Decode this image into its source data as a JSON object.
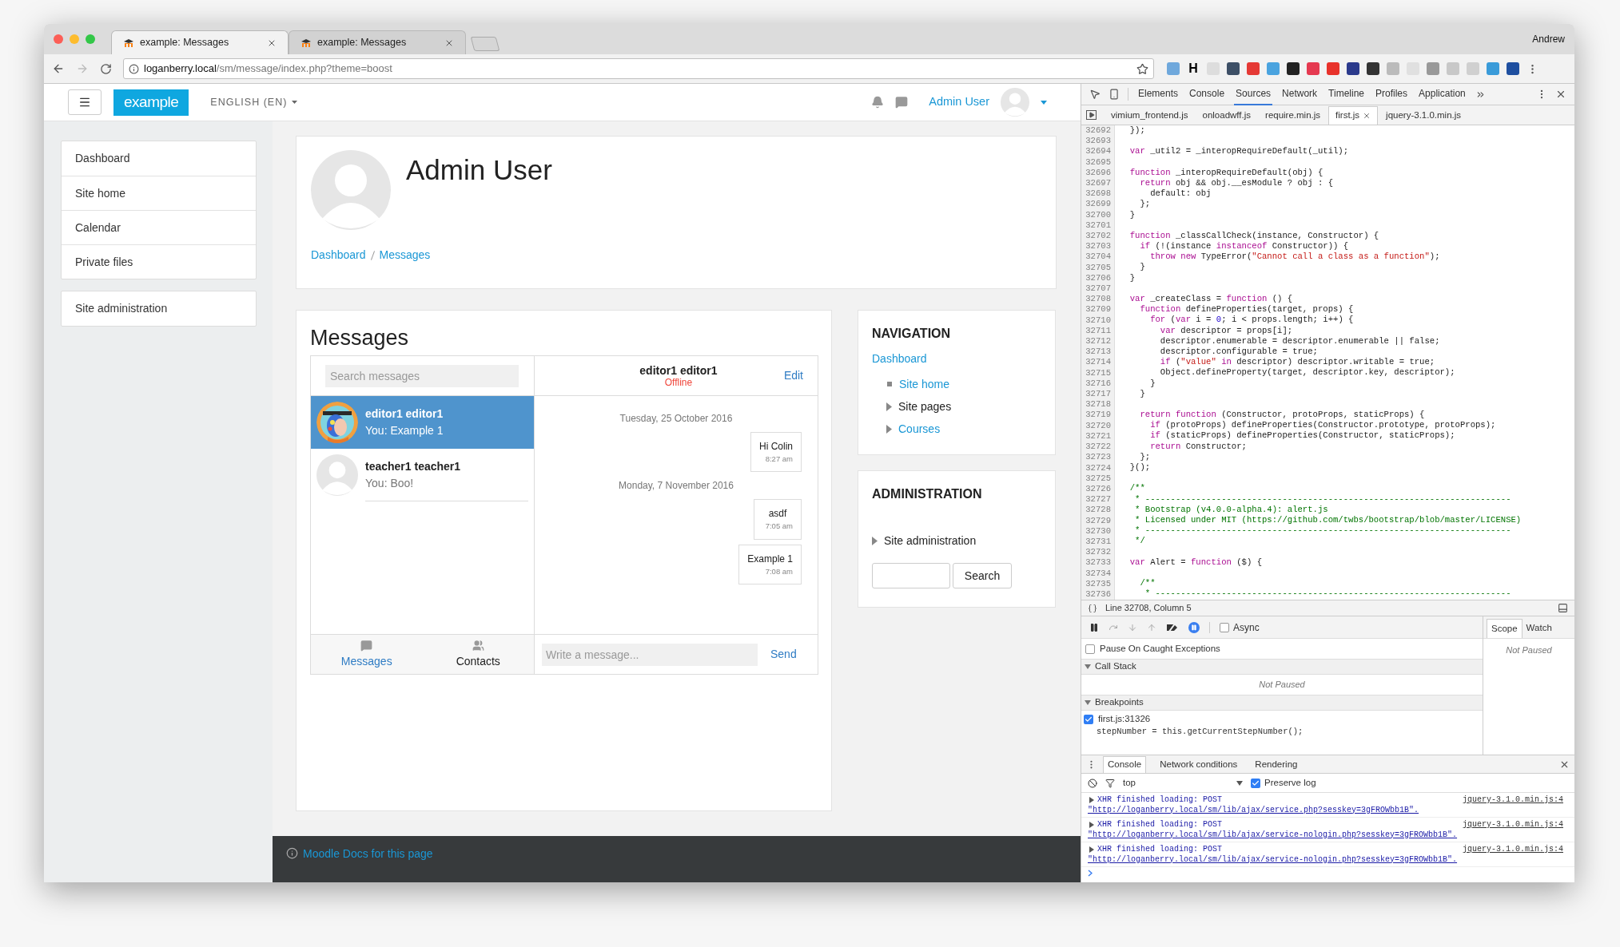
{
  "browser": {
    "tabs": [
      {
        "title": "example: Messages",
        "selected": true
      },
      {
        "title": "example: Messages",
        "selected": false
      }
    ],
    "profile": "Andrew",
    "url_host": "loganberry.local",
    "url_path": "/sm/message/index.php?theme=boost",
    "extension_letter": "H"
  },
  "navbar": {
    "logo": "example",
    "language": "ENGLISH (EN)",
    "user": "Admin User"
  },
  "sidebar": {
    "groups": [
      {
        "items": [
          "Dashboard",
          "Site home",
          "Calendar",
          "Private files"
        ]
      },
      {
        "items": [
          "Site administration"
        ]
      }
    ]
  },
  "header": {
    "name": "Admin User",
    "breadcrumb": [
      "Dashboard",
      "Messages"
    ]
  },
  "messages": {
    "title": "Messages",
    "search_placeholder": "Search messages",
    "conversations": [
      {
        "name": "editor1 editor1",
        "preview": "You: Example 1",
        "selected": true,
        "kind": "picture"
      },
      {
        "name": "teacher1 teacher1",
        "preview": "You: Boo!",
        "selected": false,
        "kind": "avatar"
      }
    ],
    "contact": {
      "name": "editor1 editor1",
      "status": "Offline"
    },
    "edit": "Edit",
    "thread": [
      {
        "kind": "date",
        "text": "Tuesday, 25 October 2016"
      },
      {
        "kind": "message",
        "text": "Hi Colin",
        "time": "8:27 am"
      },
      {
        "kind": "date",
        "text": "Monday, 7 November 2016"
      },
      {
        "kind": "message",
        "text": "asdf",
        "time": "7:05 am"
      },
      {
        "kind": "message",
        "text": "Example 1",
        "time": "7:08 am"
      }
    ],
    "tabs": [
      {
        "label": "Messages",
        "selected": true
      },
      {
        "label": "Contacts",
        "selected": false
      }
    ],
    "compose_placeholder": "Write a message...",
    "send": "Send"
  },
  "navigation": {
    "title": "NAVIGATION",
    "root": "Dashboard",
    "items": [
      {
        "label": "Site home",
        "kind": "leaf",
        "link": true
      },
      {
        "label": "Site pages",
        "kind": "branch",
        "link": false
      },
      {
        "label": "Courses",
        "kind": "branch",
        "link": true
      }
    ]
  },
  "administration": {
    "title": "ADMINISTRATION",
    "items": [
      {
        "label": "Site administration",
        "kind": "branch"
      }
    ],
    "search_button": "Search"
  },
  "footer": {
    "docs_link": "Moodle Docs for this page"
  },
  "devtools": {
    "panels": [
      {
        "label": "Elements",
        "selected": false
      },
      {
        "label": "Console",
        "selected": false
      },
      {
        "label": "Sources",
        "selected": true
      },
      {
        "label": "Network",
        "selected": false
      },
      {
        "label": "Timeline",
        "selected": false
      },
      {
        "label": "Profiles",
        "selected": false
      },
      {
        "label": "Application",
        "selected": false
      }
    ],
    "files": [
      {
        "name": "vimium_frontend.js",
        "selected": false
      },
      {
        "name": "onloadwff.js",
        "selected": false
      },
      {
        "name": "require.min.js",
        "selected": false
      },
      {
        "name": "first.js",
        "selected": true
      },
      {
        "name": "jquery-3.1.0.min.js",
        "selected": false
      }
    ],
    "code": [
      {
        "n": "32692",
        "segs": [
          {
            "text": "  });"
          }
        ]
      },
      {
        "n": "32693"
      },
      {
        "n": "32694",
        "segs": [
          {
            "text": "  var",
            "kind": "keyword"
          },
          {
            "text": " _util2 = _interopRequireDefault(_util);"
          }
        ]
      },
      {
        "n": "32695"
      },
      {
        "n": "32696",
        "segs": [
          {
            "text": "  function",
            "kind": "keyword"
          },
          {
            "text": " _interopRequireDefault(obj) {"
          }
        ]
      },
      {
        "n": "32697",
        "segs": [
          {
            "text": "    return",
            "kind": "keyword"
          },
          {
            "text": " obj && obj.__esModule ? obj : {"
          }
        ]
      },
      {
        "n": "32698",
        "segs": [
          {
            "text": "      default: obj"
          }
        ]
      },
      {
        "n": "32699",
        "segs": [
          {
            "text": "    };"
          }
        ]
      },
      {
        "n": "32700",
        "segs": [
          {
            "text": "  }"
          }
        ]
      },
      {
        "n": "32701"
      },
      {
        "n": "32702",
        "segs": [
          {
            "text": "  function",
            "kind": "keyword"
          },
          {
            "text": " _classCallCheck(instance, Constructor) {"
          }
        ]
      },
      {
        "n": "32703",
        "segs": [
          {
            "text": "    if",
            "kind": "keyword"
          },
          {
            "text": " (!(instance "
          },
          {
            "text": "instanceof",
            "kind": "keyword"
          },
          {
            "text": " Constructor)) {"
          }
        ]
      },
      {
        "n": "32704",
        "segs": [
          {
            "text": "      throw new",
            "kind": "keyword"
          },
          {
            "text": " TypeError("
          },
          {
            "text": "\"Cannot call a class as a function\"",
            "kind": "string"
          },
          {
            "text": ");"
          }
        ]
      },
      {
        "n": "32705",
        "segs": [
          {
            "text": "    }"
          }
        ]
      },
      {
        "n": "32706",
        "segs": [
          {
            "text": "  }"
          }
        ]
      },
      {
        "n": "32707"
      },
      {
        "n": "32708",
        "segs": [
          {
            "text": "  var",
            "kind": "keyword"
          },
          {
            "text": " _createClass = "
          },
          {
            "text": "function",
            "kind": "keyword"
          },
          {
            "text": " () {"
          }
        ]
      },
      {
        "n": "32709",
        "segs": [
          {
            "text": "    function",
            "kind": "keyword"
          },
          {
            "text": " defineProperties(target, props) {"
          }
        ]
      },
      {
        "n": "32710",
        "segs": [
          {
            "text": "      for",
            "kind": "keyword"
          },
          {
            "text": " ("
          },
          {
            "text": "var",
            "kind": "keyword"
          },
          {
            "text": " i = "
          },
          {
            "text": "0",
            "kind": "number"
          },
          {
            "text": "; i < props.length; i++) {"
          }
        ]
      },
      {
        "n": "32711",
        "segs": [
          {
            "text": "        var",
            "kind": "keyword"
          },
          {
            "text": " descriptor = props[i];"
          }
        ]
      },
      {
        "n": "32712",
        "segs": [
          {
            "text": "        descriptor.enumerable = descriptor.enumerable || false;"
          }
        ]
      },
      {
        "n": "32713",
        "segs": [
          {
            "text": "        descriptor.configurable = true;"
          }
        ]
      },
      {
        "n": "32714",
        "segs": [
          {
            "text": "        if",
            "kind": "keyword"
          },
          {
            "text": " ("
          },
          {
            "text": "\"value\"",
            "kind": "string"
          },
          {
            "text": " in",
            "kind": "keyword"
          },
          {
            "text": " descriptor) descriptor.writable = true;"
          }
        ]
      },
      {
        "n": "32715",
        "segs": [
          {
            "text": "        Object.defineProperty(target, descriptor.key, descriptor);"
          }
        ]
      },
      {
        "n": "32716",
        "segs": [
          {
            "text": "      }"
          }
        ]
      },
      {
        "n": "32717",
        "segs": [
          {
            "text": "    }"
          }
        ]
      },
      {
        "n": "32718"
      },
      {
        "n": "32719",
        "segs": [
          {
            "text": "    return function",
            "kind": "keyword"
          },
          {
            "text": " (Constructor, protoProps, staticProps) {"
          }
        ]
      },
      {
        "n": "32720",
        "segs": [
          {
            "text": "      if",
            "kind": "keyword"
          },
          {
            "text": " (protoProps) defineProperties(Constructor.prototype, protoProps);"
          }
        ]
      },
      {
        "n": "32721",
        "segs": [
          {
            "text": "      if",
            "kind": "keyword"
          },
          {
            "text": " (staticProps) defineProperties(Constructor, staticProps);"
          }
        ]
      },
      {
        "n": "32722",
        "segs": [
          {
            "text": "      return",
            "kind": "keyword"
          },
          {
            "text": " Constructor;"
          }
        ]
      },
      {
        "n": "32723",
        "segs": [
          {
            "text": "    };"
          }
        ]
      },
      {
        "n": "32724",
        "segs": [
          {
            "text": "  }();"
          }
        ]
      },
      {
        "n": "32725"
      },
      {
        "n": "32726",
        "segs": [
          {
            "text": "  /**",
            "kind": "comment"
          }
        ]
      },
      {
        "n": "32727",
        "segs": [
          {
            "text": "   * ------------------------------------------------------------------------",
            "kind": "comment"
          }
        ]
      },
      {
        "n": "32728",
        "segs": [
          {
            "text": "   * Bootstrap (v4.0.0-alpha.4): alert.js",
            "kind": "comment"
          }
        ]
      },
      {
        "n": "32729",
        "segs": [
          {
            "text": "   * Licensed under MIT (https://github.com/twbs/bootstrap/blob/master/LICENSE)",
            "kind": "comment"
          }
        ]
      },
      {
        "n": "32730",
        "segs": [
          {
            "text": "   * ------------------------------------------------------------------------",
            "kind": "comment"
          }
        ]
      },
      {
        "n": "32731",
        "segs": [
          {
            "text": "   */",
            "kind": "comment"
          }
        ]
      },
      {
        "n": "32732"
      },
      {
        "n": "32733",
        "segs": [
          {
            "text": "  var",
            "kind": "keyword"
          },
          {
            "text": " Alert = "
          },
          {
            "text": "function",
            "kind": "keyword"
          },
          {
            "text": " ($) {"
          }
        ]
      },
      {
        "n": "32734"
      },
      {
        "n": "32735",
        "segs": [
          {
            "text": "    /**",
            "kind": "comment"
          }
        ]
      },
      {
        "n": "32736",
        "segs": [
          {
            "text": "     * ----------------------------------------------------------------------",
            "kind": "comment"
          }
        ]
      }
    ],
    "position": "Line 32708, Column 5",
    "async": {
      "label": "Async",
      "checked": false
    },
    "sidebar_tabs": [
      {
        "label": "Scope",
        "selected": true
      },
      {
        "label": "Watch",
        "selected": false
      }
    ],
    "scope_status": "Not Paused",
    "pause_caught": {
      "label": "Pause On Caught Exceptions",
      "checked": false
    },
    "call_stack": {
      "title": "Call Stack",
      "expanded": true,
      "status": "Not Paused"
    },
    "breakpoints": {
      "title": "Breakpoints",
      "expanded": true,
      "items": [
        {
          "location": "first.js:31326",
          "code": "stepNumber = this.getCurrentStepNumber();",
          "checked": true
        }
      ]
    },
    "drawer_tabs": [
      {
        "label": "Console",
        "selected": true
      },
      {
        "label": "Network conditions",
        "selected": false
      },
      {
        "label": "Rendering",
        "selected": false
      }
    ],
    "context": "top",
    "preserve_log": {
      "label": "Preserve log",
      "checked": true
    },
    "logs": [
      {
        "message": "XHR finished loading: POST",
        "source": "jquery-3.1.0.min.js:4",
        "detail": "\"http://loganberry.local/sm/lib/ajax/service.php?sesskey=3gFROWbb1B\"."
      },
      {
        "message": "XHR finished loading: POST",
        "source": "jquery-3.1.0.min.js:4",
        "detail": "\"http://loganberry.local/sm/lib/ajax/service-nologin.php?sesskey=3gFROWbb1B\"."
      },
      {
        "message": "XHR finished loading: POST",
        "source": "jquery-3.1.0.min.js:4",
        "detail": "\"http://loganberry.local/sm/lib/ajax/service-nologin.php?sesskey=3gFROWbb1B\"."
      }
    ]
  }
}
